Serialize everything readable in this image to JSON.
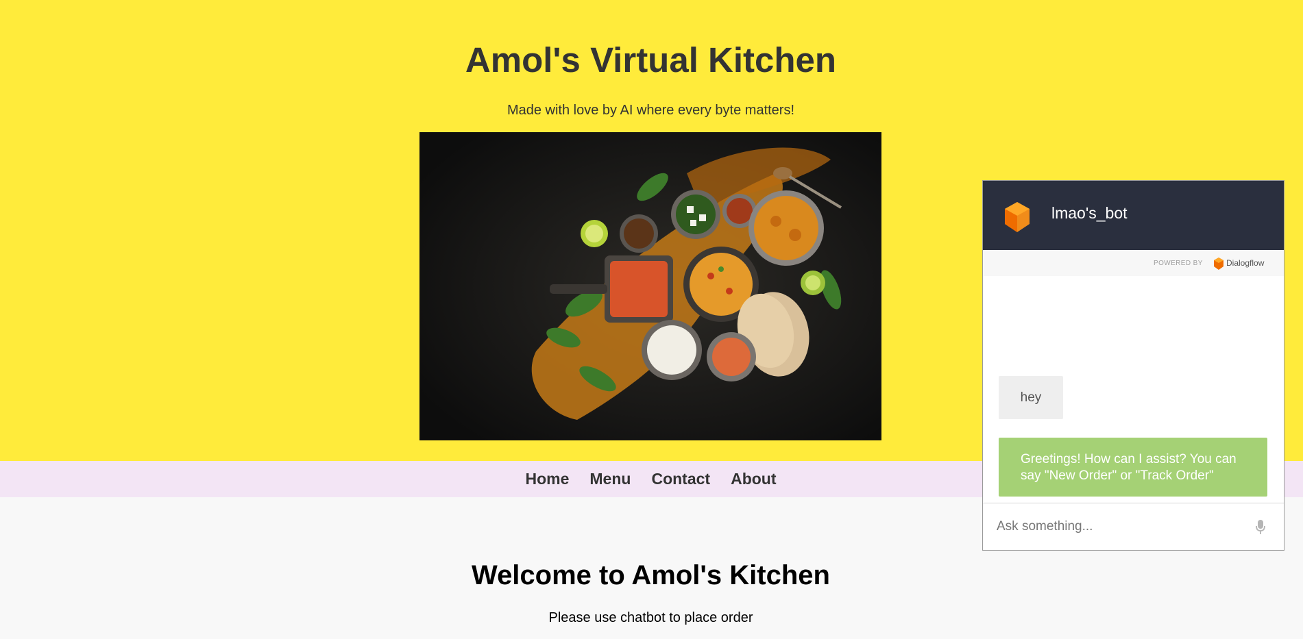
{
  "header": {
    "title": "Amol's Virtual Kitchen",
    "tagline": "Made with love by AI where every byte matters!",
    "hero_icon": "food-photo"
  },
  "nav": {
    "items": [
      {
        "label": "Home"
      },
      {
        "label": "Menu"
      },
      {
        "label": "Contact"
      },
      {
        "label": "About"
      }
    ]
  },
  "main": {
    "welcome_title": "Welcome to Amol's Kitchen",
    "welcome_subtitle": "Please use chatbot to place order"
  },
  "chat": {
    "bot_name": "lmao's_bot",
    "powered_by": "POWERED BY",
    "provider": "Dialogflow",
    "messages": [
      {
        "from": "user",
        "text": "hey"
      },
      {
        "from": "bot",
        "text": "Greetings! How can I assist? You can say \"New Order\" or \"Track Order\""
      }
    ],
    "input_placeholder": "Ask something...",
    "mic_icon": "microphone-icon"
  },
  "colors": {
    "header_bg": "#ffeb3b",
    "nav_bg": "#f3e5f5",
    "page_bg": "#f8f8f8",
    "chat_header_bg": "#2a2f3e",
    "bot_bubble": "#a5d175",
    "user_bubble": "#eeeeee",
    "dialogflow_orange": "#ef6c00"
  }
}
